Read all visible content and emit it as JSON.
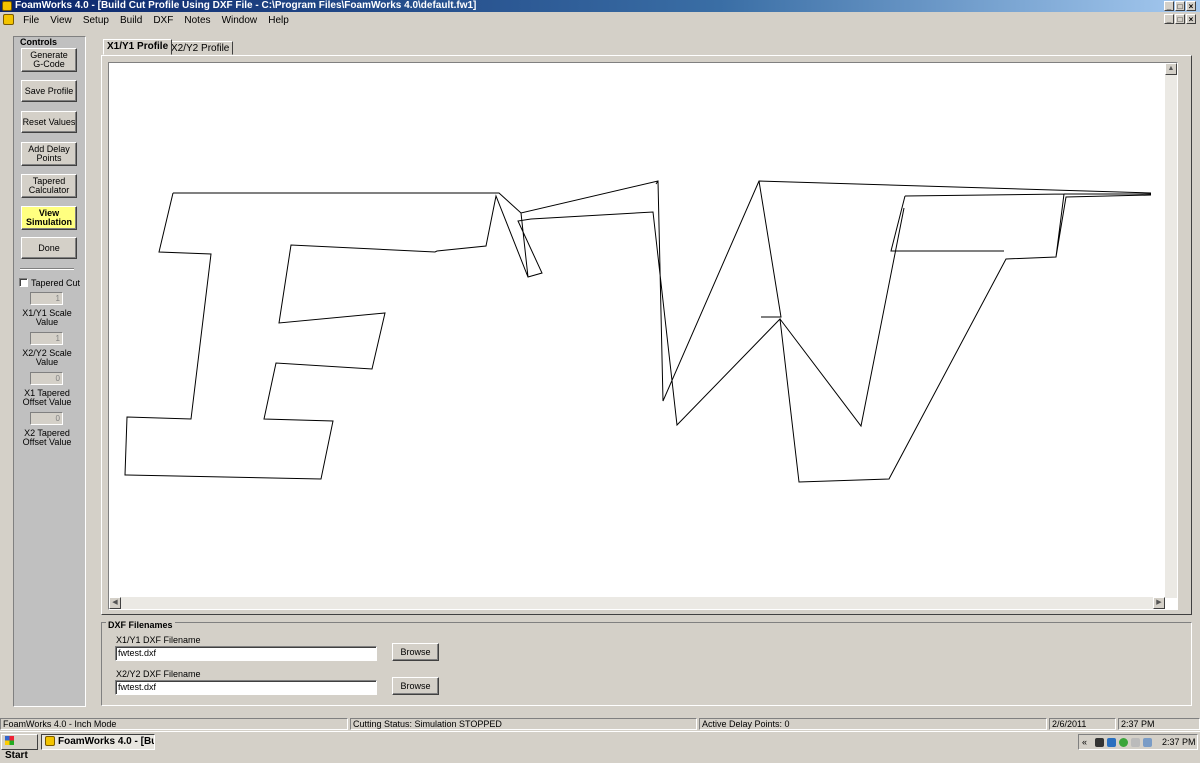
{
  "window": {
    "title": "FoamWorks 4.0 - [Build Cut Profile Using DXF File - C:\\Program Files\\FoamWorks 4.0\\default.fw1]",
    "controls": [
      "_",
      "□",
      "×"
    ]
  },
  "menu": [
    "File",
    "View",
    "Setup",
    "Build",
    "DXF",
    "Notes",
    "Window",
    "Help"
  ],
  "controls": {
    "title": "Controls",
    "buttons": [
      {
        "label": "Generate\nG-Code",
        "highlight": false
      },
      {
        "label": "Save Profile",
        "highlight": false
      },
      {
        "label": "Reset Values",
        "highlight": false
      },
      {
        "label": "Add Delay\nPoints",
        "highlight": false
      },
      {
        "label": "Tapered\nCalculator",
        "highlight": false
      },
      {
        "label": "View\nSimulation",
        "highlight": true
      },
      {
        "label": "Done",
        "highlight": false
      }
    ],
    "tapered_cut_label": "Tapered Cut",
    "tapered_cut_checked": false,
    "fields": [
      {
        "value": "1",
        "label": "X1/Y1 Scale\nValue"
      },
      {
        "value": "1",
        "label": "X2/Y2 Scale\nValue"
      },
      {
        "value": "0",
        "label": "X1 Tapered\nOffset  Value"
      },
      {
        "value": "0",
        "label": "X2 Tapered\nOffset  Value"
      }
    ]
  },
  "tabs": [
    {
      "label": "X1/Y1 Profile",
      "active": true
    },
    {
      "label": "X2/Y2 Profile",
      "active": false
    }
  ],
  "dxf": {
    "title": "DXF Filenames",
    "x1_label": "X1/Y1 DXF Filename",
    "x1_value": "fwtest.dxf",
    "x2_label": "X2/Y2 DXF Filename",
    "x2_value": "fwtest.dxf",
    "browse_label": "Browse"
  },
  "status": {
    "mode": "FoamWorks 4.0 - Inch Mode",
    "cutting": "Cutting Status: Simulation STOPPED",
    "delay": "Active Delay Points: 0",
    "date": "2/6/2011",
    "time": "2:37 PM"
  },
  "taskbar": {
    "start": "Start",
    "task": "FoamWorks 4.0 - [Bu...",
    "tray_time": "2:37 PM",
    "tray_chevron": "«"
  },
  "colors": {
    "title_bar": "#0a246a",
    "highlight_button": "#ffff80",
    "canvas": "#ffffff",
    "profile_line": "#000000"
  }
}
